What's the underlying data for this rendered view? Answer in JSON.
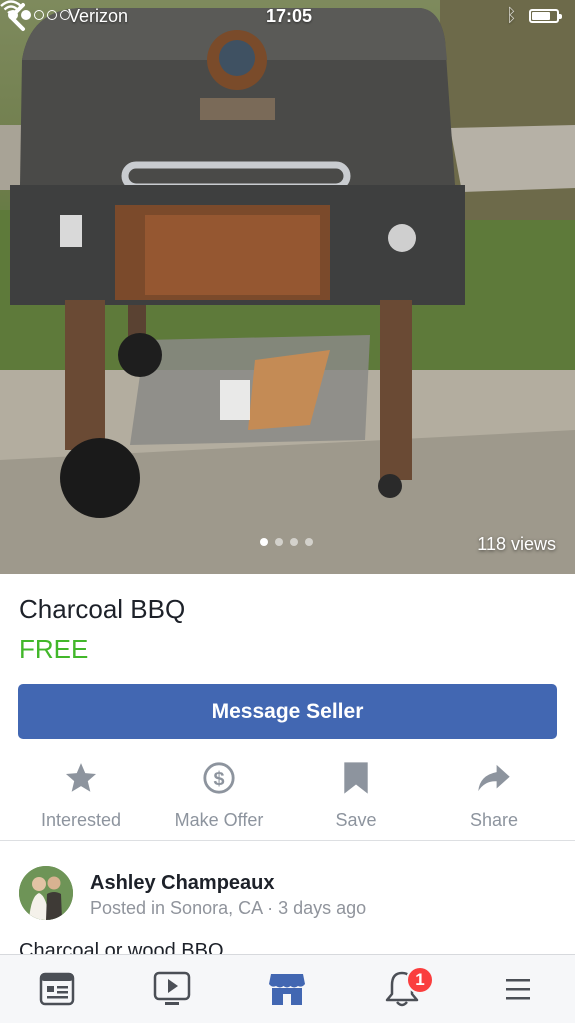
{
  "status_bar": {
    "carrier": "Verizon",
    "time": "17:05",
    "signal_bars_filled": 2,
    "signal_bars_total": 5,
    "battery_level": 0.68
  },
  "photo": {
    "views": "118 views",
    "image_count": 4,
    "active_index": 0
  },
  "listing": {
    "title": "Charcoal BBQ",
    "price": "FREE",
    "message_button": "Message Seller"
  },
  "actions": [
    {
      "label": "Interested",
      "icon": "star-icon"
    },
    {
      "label": "Make Offer",
      "icon": "dollar-icon"
    },
    {
      "label": "Save",
      "icon": "bookmark-icon"
    },
    {
      "label": "Share",
      "icon": "share-icon"
    }
  ],
  "seller": {
    "name": "Ashley Champeaux",
    "posted": "Posted in Sonora, CA · 3 days ago"
  },
  "description": "Charcoal or wood BBQ",
  "tabbar": {
    "tabs": [
      "news-feed-icon",
      "video-icon",
      "marketplace-icon",
      "notifications-icon",
      "menu-icon"
    ],
    "active_tab": "marketplace-icon",
    "notification_count": "1"
  },
  "colors": {
    "brand_blue": "#4267b2",
    "price_green": "#42b72a",
    "badge_red": "#fa3e3e",
    "muted_gray": "#8d949e"
  }
}
